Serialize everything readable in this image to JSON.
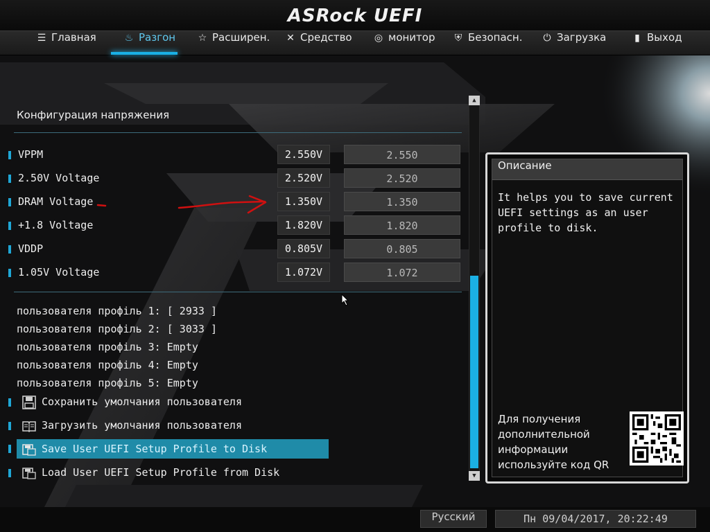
{
  "app": {
    "brand": "ASRock UEFI"
  },
  "nav": {
    "tabs": [
      {
        "label": "Главная",
        "icon": "list-icon"
      },
      {
        "label": "Разгон",
        "icon": "flame-icon",
        "active": true
      },
      {
        "label": "Расширен.",
        "icon": "star-icon"
      },
      {
        "label": "Средство",
        "icon": "tools-icon"
      },
      {
        "label": "монитор",
        "icon": "monitor-icon"
      },
      {
        "label": "Безопасн.",
        "icon": "shield-icon"
      },
      {
        "label": "Загрузка",
        "icon": "power-icon"
      },
      {
        "label": "Выход",
        "icon": "exit-door-icon"
      }
    ]
  },
  "section": {
    "title": "Конфигурация напряжения"
  },
  "voltages": [
    {
      "label": "VPPM",
      "reading": "2.550V",
      "value": "2.550"
    },
    {
      "label": "2.50V Voltage",
      "reading": "2.520V",
      "value": "2.520"
    },
    {
      "label": "DRAM Voltage",
      "reading": "1.350V",
      "value": "1.350"
    },
    {
      "label": "+1.8 Voltage",
      "reading": "1.820V",
      "value": "1.820"
    },
    {
      "label": "VDDP",
      "reading": "0.805V",
      "value": "0.805"
    },
    {
      "label": "1.05V Voltage",
      "reading": "1.072V",
      "value": "1.072"
    }
  ],
  "profiles": [
    "пользователя профіль 1: [ 2933 ]",
    "пользователя профіль 2: [ 3033 ]",
    "пользователя профіль 3: Empty",
    "пользователя профіль 4: Empty",
    "пользователя профіль 5: Empty"
  ],
  "actions": [
    {
      "label": "Сохранить умолчания пользователя",
      "icon": "save-icon"
    },
    {
      "label": "Загрузить умолчания пользователя",
      "icon": "book-icon"
    },
    {
      "label": "Save User UEFI Setup Profile to Disk",
      "icon": "save-disk-icon",
      "selected": true
    },
    {
      "label": "Load User UEFI Setup Profile from Disk",
      "icon": "load-disk-icon"
    }
  ],
  "description": {
    "title": "Описание",
    "text": "It helps you to save current UEFI settings as an user profile to disk.",
    "qr_text": "Для получения дополнительной информации используйте код QR"
  },
  "footer": {
    "language": "Русский",
    "datetime": "Пн 09/04/2017, 20:22:49"
  },
  "colors": {
    "accent": "#1ab0e6",
    "selected_row": "#1f8ba8",
    "annotation": "#d01010"
  }
}
